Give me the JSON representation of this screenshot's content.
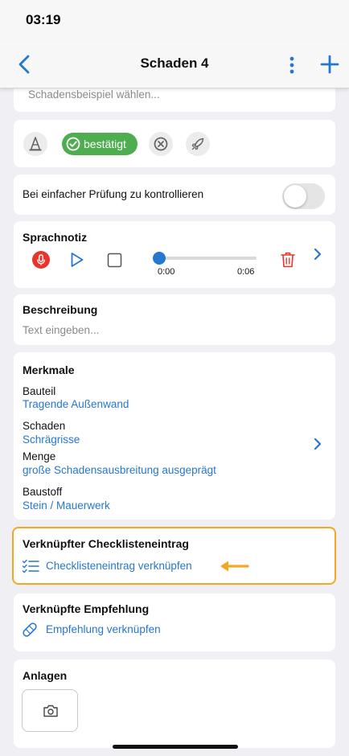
{
  "status": {
    "time": "03:19"
  },
  "nav": {
    "title": "Schaden 4",
    "back_icon": "chevron-left-icon",
    "more_icon": "more-vertical-icon",
    "add_icon": "plus-icon"
  },
  "example": {
    "placeholder": "Schadensbeispiel wählen..."
  },
  "status_chips": {
    "confirmed_label": "bestätigt",
    "icons": [
      "traffic-cone-icon",
      "check-circle-icon",
      "x-circle-icon",
      "rocket-icon"
    ]
  },
  "simple_check": {
    "label": "Bei einfacher Prüfung zu kontrollieren",
    "toggle_on": false
  },
  "voice_note": {
    "title": "Sprachnotiz",
    "current_time": "0:00",
    "duration": "0:06",
    "progress": 0
  },
  "description": {
    "title": "Beschreibung",
    "placeholder": "Text eingeben..."
  },
  "features": {
    "title": "Merkmale",
    "items": [
      {
        "label": "Bauteil",
        "value": "Tragende Außenwand"
      },
      {
        "label": "Schaden",
        "value": "Schrägrisse"
      },
      {
        "label": "Menge",
        "value": "große Schadensausbreitung ausgeprägt"
      },
      {
        "label": "Baustoff",
        "value": "Stein / Mauerwerk"
      }
    ]
  },
  "checklist": {
    "title": "Verknüpfter Checklisteneintrag",
    "link_label": "Checklisteneintrag verknüpfen"
  },
  "recommendation": {
    "title": "Verknüpfte Empfehlung",
    "link_label": "Empfehlung verknüpfen"
  },
  "attachments": {
    "title": "Anlagen"
  },
  "colors": {
    "accent": "#2577cf",
    "confirmed": "#4eae4f",
    "highlight": "#f5a623",
    "record": "#e8352b",
    "delete": "#e8352b"
  }
}
